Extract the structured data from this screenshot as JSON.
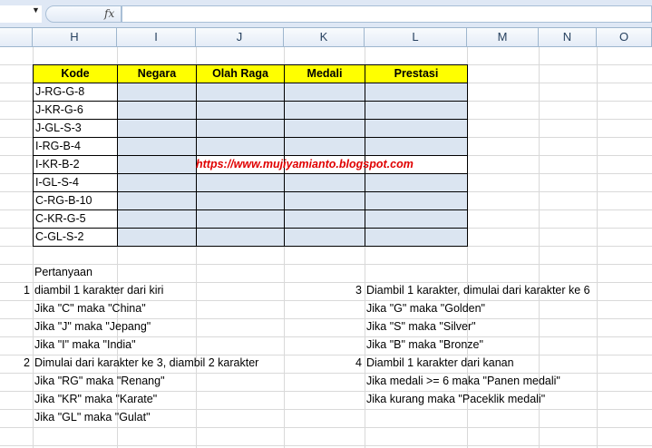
{
  "formula_bar": {
    "name_box": "",
    "fx_label": "fx",
    "formula": ""
  },
  "columns": [
    "H",
    "I",
    "J",
    "K",
    "L",
    "M",
    "N",
    "O"
  ],
  "table": {
    "headers": [
      "Kode",
      "Negara",
      "Olah Raga",
      "Medali",
      "Prestasi"
    ],
    "codes": [
      "J-RG-G-8",
      "J-KR-G-6",
      "J-GL-S-3",
      "I-RG-B-4",
      "I-KR-B-2",
      "I-GL-S-4",
      "C-RG-B-10",
      "C-KR-G-5",
      "C-GL-S-2"
    ]
  },
  "watermark_url": "https://www.mujiyamianto.blogspot.com",
  "notes": {
    "title": "Pertanyaan",
    "left": [
      {
        "num": "1",
        "text": "diambil 1 karakter dari kiri"
      },
      {
        "num": "",
        "text": "Jika \"C\" maka \"China\""
      },
      {
        "num": "",
        "text": "Jika \"J\" maka \"Jepang\""
      },
      {
        "num": "",
        "text": "Jika \"I\" maka \"India\""
      },
      {
        "num": "2",
        "text": "Dimulai dari karakter ke 3, diambil 2 karakter"
      },
      {
        "num": "",
        "text": "Jika \"RG\" maka \"Renang\""
      },
      {
        "num": "",
        "text": "Jika \"KR\" maka \"Karate\""
      },
      {
        "num": "",
        "text": "Jika \"GL\" maka \"Gulat\""
      }
    ],
    "right": [
      {
        "num": "3",
        "text": "Diambil 1 karakter, dimulai dari karakter ke 6"
      },
      {
        "num": "",
        "text": "Jika \"G\" maka \"Golden\""
      },
      {
        "num": "",
        "text": "Jika \"S\" maka \"Silver\""
      },
      {
        "num": "",
        "text": "Jika \"B\" maka \"Bronze\""
      },
      {
        "num": "4",
        "text": "Diambil 1 karakter dari kanan"
      },
      {
        "num": "",
        "text": "Jika medali >= 6 maka \"Panen medali\""
      },
      {
        "num": "",
        "text": "Jika kurang maka \"Paceklik medali\""
      }
    ]
  }
}
